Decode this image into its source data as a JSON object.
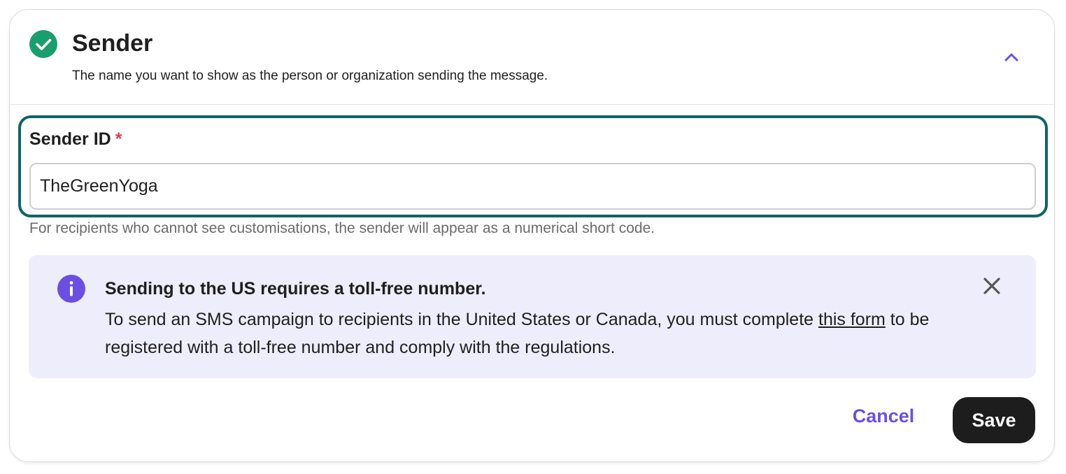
{
  "section": {
    "title": "Sender",
    "subtitle": "The name you want to show as the person or organization sending the message.",
    "status_icon": "check-circle-icon",
    "collapse_icon": "chevron-up-icon",
    "accent_color": "#1a9e6e"
  },
  "sender_field": {
    "label": "Sender ID",
    "required_marker": "*",
    "value": "TheGreenYoga",
    "help_text": "For recipients who cannot see customisations, the sender will appear as a numerical short code.",
    "focus_color": "#0f6466"
  },
  "info_banner": {
    "icon": "info-icon",
    "title": "Sending to the US requires a toll-free number.",
    "body_before_link": "To send an SMS campaign to recipients in the United States or Canada, you must complete ",
    "link_text": "this form",
    "body_after_link": " to be registered with a toll-free number and comply with the regulations.",
    "close_icon": "close-icon",
    "background": "#eeedfb",
    "icon_color": "#6a4fe0"
  },
  "actions": {
    "cancel_label": "Cancel",
    "save_label": "Save",
    "cancel_color": "#6a4fe0",
    "save_background": "#1d1d1d"
  }
}
